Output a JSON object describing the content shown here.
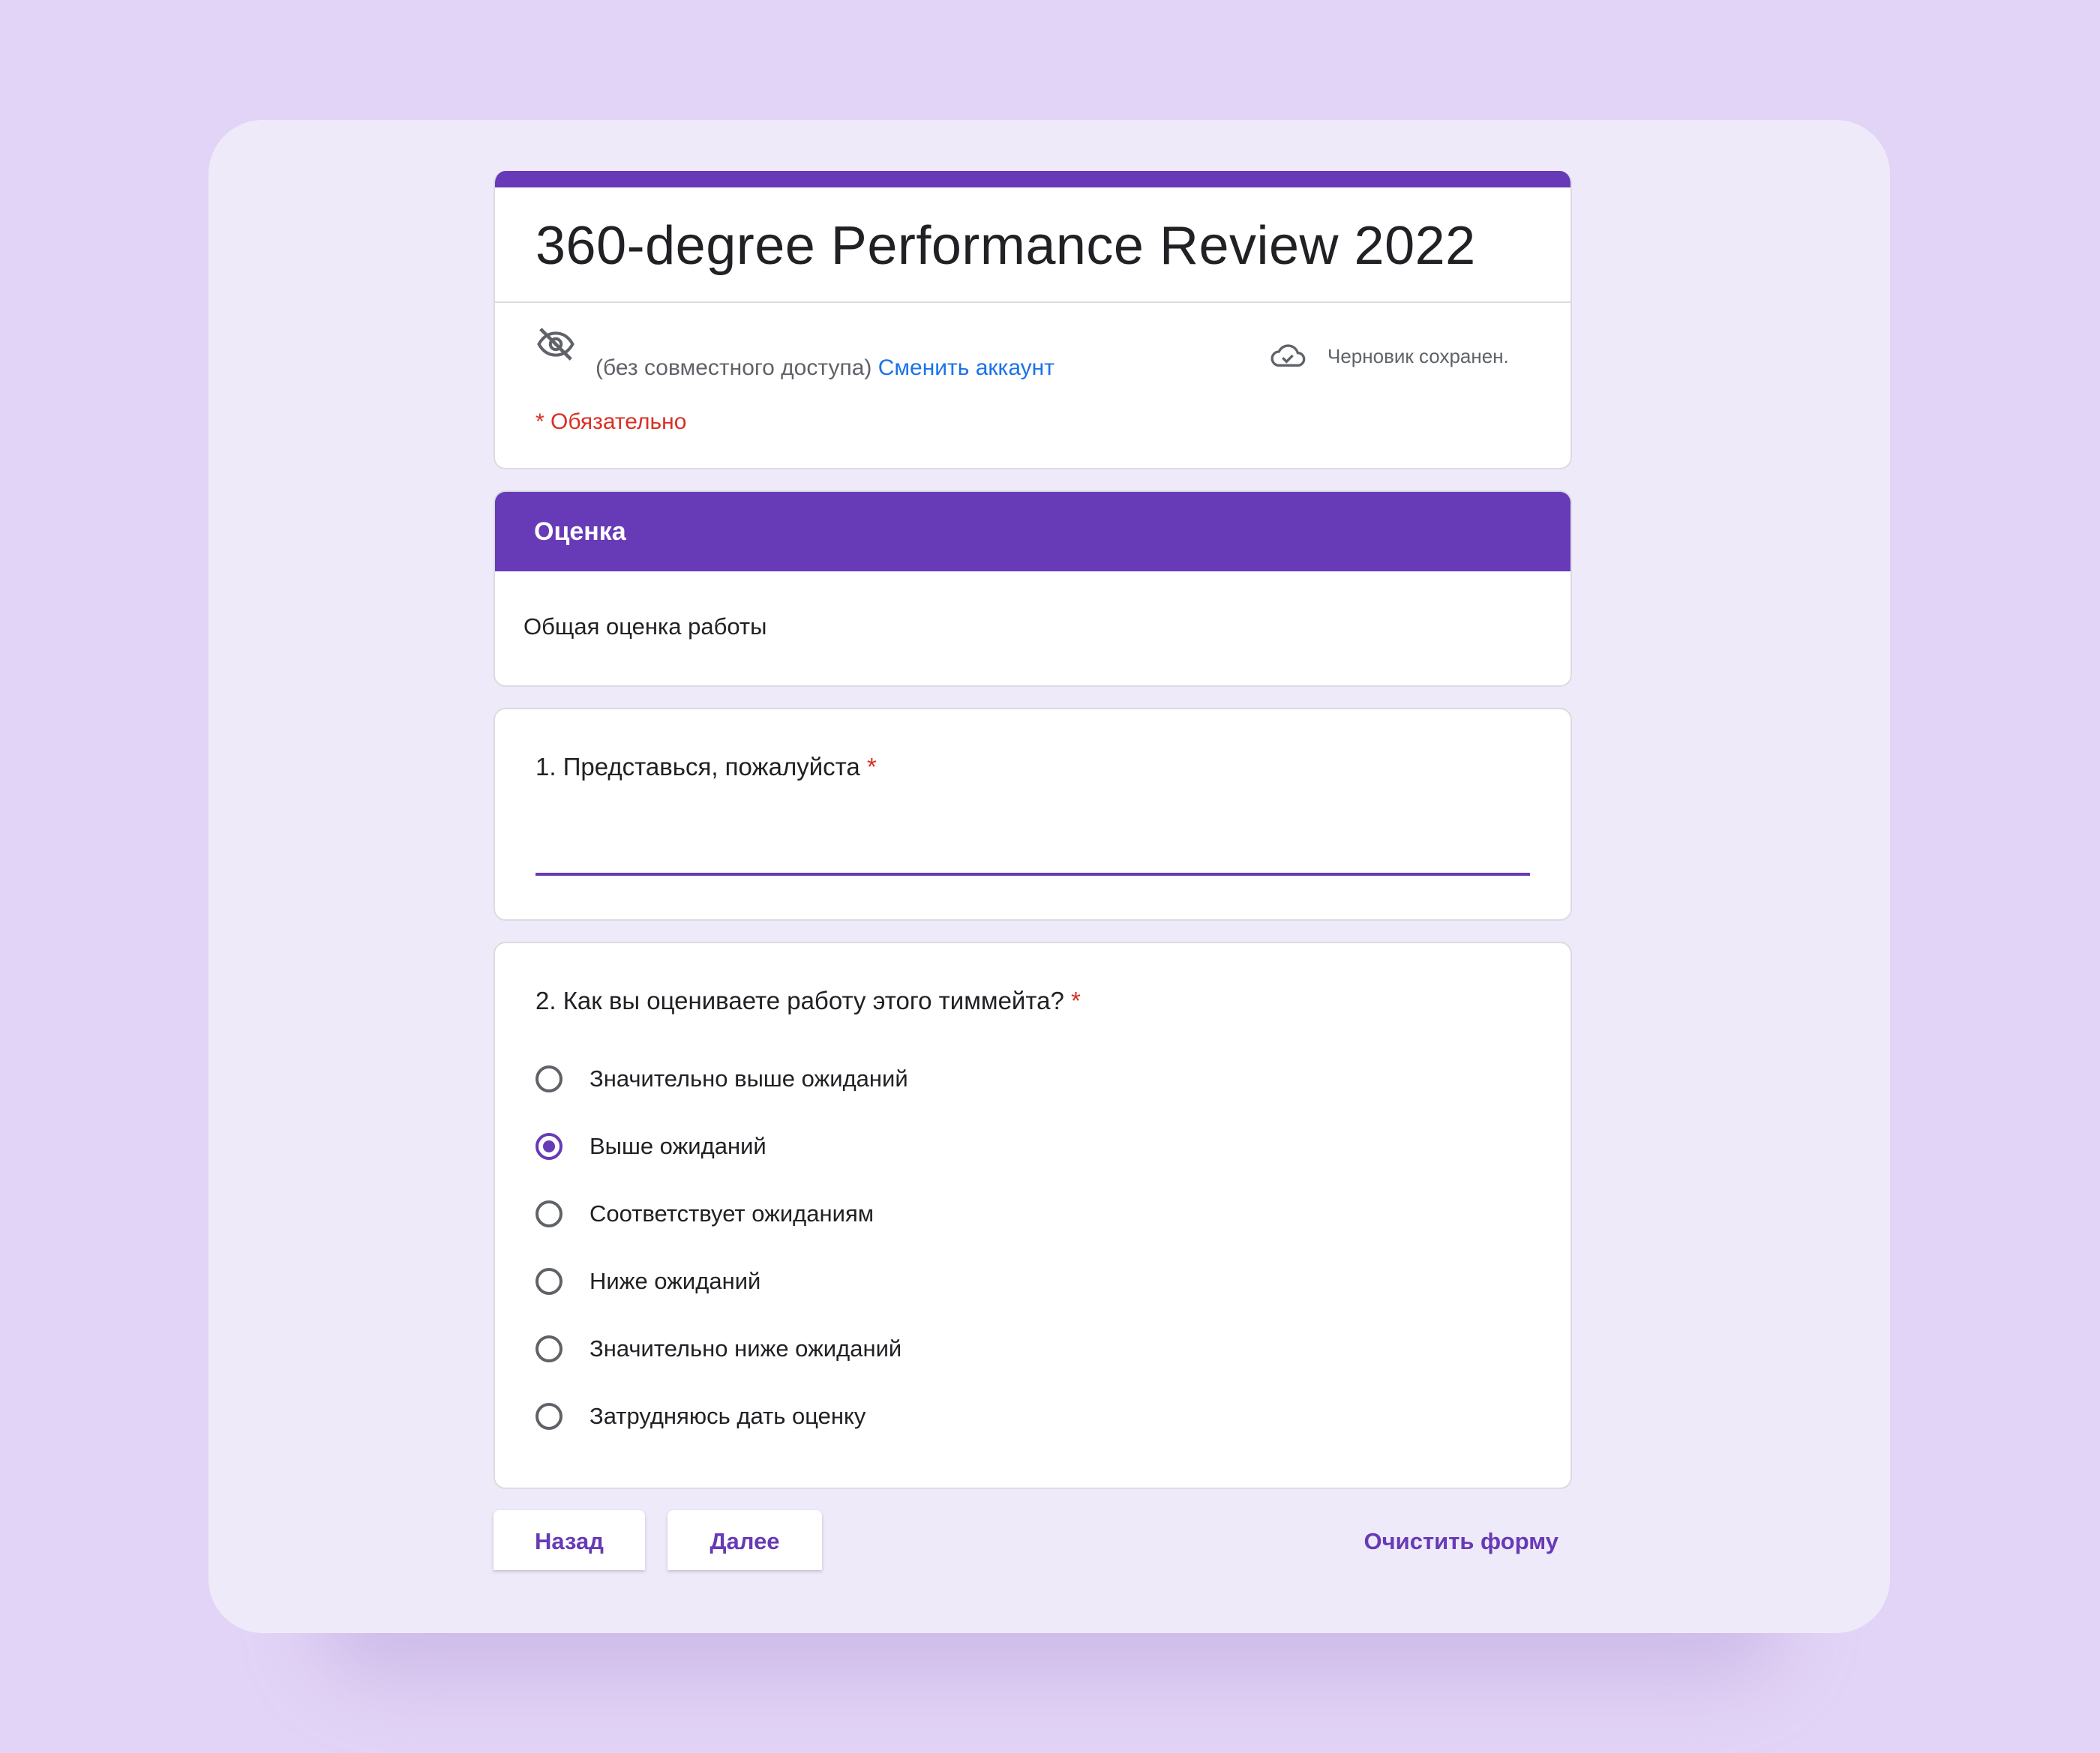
{
  "colors": {
    "accent": "#673ab7",
    "required": "#d93025",
    "link": "#1a73e8",
    "background": "#e2d4f6"
  },
  "form": {
    "title": "360-degree Performance Review 2022",
    "account_status": "(без совместного доступа)",
    "switch_account": "Сменить аккаунт",
    "draft_status": "Черновик сохранен.",
    "required_note": "* Обязательно",
    "icons": {
      "visibility": "eye-off-icon",
      "save": "cloud-check-icon"
    }
  },
  "section": {
    "title": "Оценка",
    "description": "Общая оценка работы"
  },
  "questions": [
    {
      "title": "1. Представься, пожалуйста",
      "required_mark": "*",
      "answer": ""
    },
    {
      "title": "2. Как вы оцениваете работу этого тиммейта?",
      "required_mark": "*",
      "options": [
        "Значительно выше ожиданий",
        "Выше ожиданий",
        "Соответствует ожиданиям",
        "Ниже ожиданий",
        "Значительно ниже ожиданий",
        "Затрудняюсь дать оценку"
      ],
      "selected_index": 1
    }
  ],
  "footer": {
    "back": "Назад",
    "next": "Далее",
    "clear": "Очистить форму"
  }
}
